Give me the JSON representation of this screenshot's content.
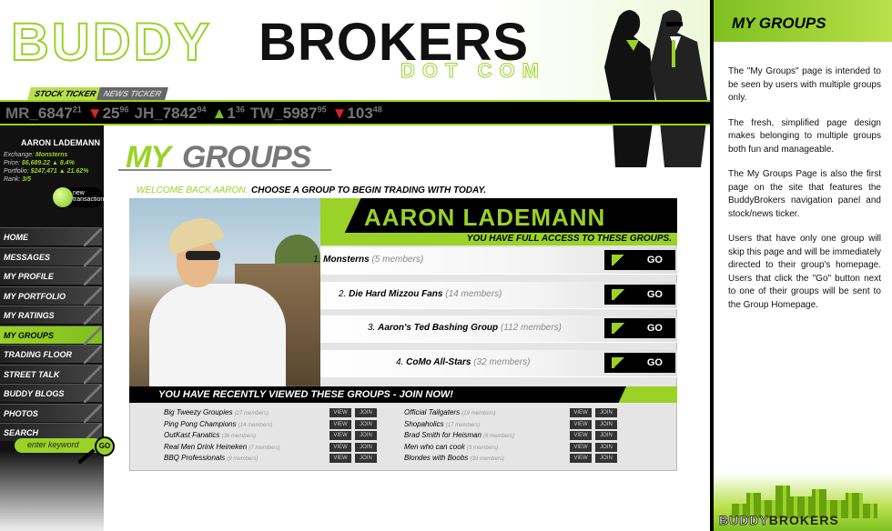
{
  "header": {
    "logo_part1": "BUDDY",
    "logo_part2": "BROKERS",
    "logo_sub": "DOT COM",
    "tab_stock": "STOCK TICKER",
    "tab_news": "NEWS TICKER"
  },
  "ticker": [
    {
      "sym": "MR",
      "val": "_6847",
      "sup": "21",
      "dir": "none"
    },
    {
      "sym": "▼",
      "val": "25",
      "sup": "96",
      "dir": "down"
    },
    {
      "sym": "JH",
      "val": "_7842",
      "sup": "94",
      "dir": "none"
    },
    {
      "sym": "▲",
      "val": "1",
      "sup": "36",
      "dir": "up"
    },
    {
      "sym": "TW",
      "val": "_5987",
      "sup": "95",
      "dir": "none"
    },
    {
      "sym": "▼",
      "val": "103",
      "sup": "48",
      "dir": "down"
    }
  ],
  "profile": {
    "name": "AARON LADEMANN",
    "exchange_label": "Exchange:",
    "exchange": "Monsterns",
    "price_label": "Price:",
    "price": "$6,689.22",
    "price_chg": "▲ 8.4%",
    "portfolio_label": "Portfolio:",
    "portfolio": "$247,471",
    "portfolio_chg": "▲ 21.62%",
    "rank_label": "Rank:",
    "rank": "3/5",
    "new_tx": "new transaction"
  },
  "nav": [
    "HOME",
    "MESSAGES",
    "MY PROFILE",
    "MY PORTFOLIO",
    "MY RATINGS",
    "MY GROUPS",
    "TRADING FLOOR",
    "STREET TALK",
    "BUDDY BLOGS",
    "PHOTOS",
    "SEARCH"
  ],
  "nav_active": "MY GROUPS",
  "search": {
    "placeholder": "enter keyword",
    "go": "GO"
  },
  "page": {
    "title_a": "MY",
    "title_b": "GROUPS",
    "welcome": "WELCOME BACK AARON.",
    "choose": "CHOOSE A GROUP TO BEGIN TRADING WITH TODAY."
  },
  "user_banner": {
    "name": "AARON LADEMANN",
    "access": "YOU HAVE FULL ACCESS TO THESE GROUPS."
  },
  "groups": [
    {
      "n": "1.",
      "name": "Monsterns",
      "members": "(5 members)",
      "go": "GO"
    },
    {
      "n": "2.",
      "name": "Die Hard Mizzou Fans",
      "members": "(14 members)",
      "go": "GO"
    },
    {
      "n": "3.",
      "name": "Aaron's Ted Bashing Group",
      "members": "(112 members)",
      "go": "GO"
    },
    {
      "n": "4.",
      "name": "CoMo All-Stars",
      "members": "(32 members)",
      "go": "GO"
    }
  ],
  "recent": {
    "title": "YOU HAVE RECENTLY VIEWED THESE GROUPS - JOIN NOW!",
    "view": "VIEW",
    "join": "JOIN",
    "left": [
      {
        "name": "Big Tweezy Groupies",
        "members": "(27 members)"
      },
      {
        "name": "Ping Pong Champions",
        "members": "(14 members)"
      },
      {
        "name": "OutKast Fanatics",
        "members": "(36 members)"
      },
      {
        "name": "Real Men Drink Heineken",
        "members": "(7 members)"
      },
      {
        "name": "BBQ Professionals",
        "members": "(9 members)"
      }
    ],
    "right": [
      {
        "name": "Official Tailgaters",
        "members": "(19 members)"
      },
      {
        "name": "Shopaholics",
        "members": "(17 members)"
      },
      {
        "name": "Brad Smith for Heisman",
        "members": "(6 members)"
      },
      {
        "name": "Men who can cook",
        "members": "(3 members)"
      },
      {
        "name": "Blondes with Boobs",
        "members": "(39 members)"
      }
    ]
  },
  "right_panel": {
    "title": "MY GROUPS",
    "paras": [
      "The \"My Groups\" page is intended to be seen by users with multiple groups only.",
      "The fresh, simplified page design makes belonging to multiple groups both fun and manageable.",
      "The My Groups Page is also the first page on the site that features the BuddyBrokers navigation panel and stock/news ticker.",
      "Users that have only one group will skip this page and will be immediately directed to their group's homepage. Users that click the \"Go\" button next to one of their groups will be sent to the Group Homepage."
    ],
    "logo_a": "BUDDY",
    "logo_b": "BROKERS"
  },
  "colors": {
    "accent": "#9ad227",
    "dark": "#000000",
    "down": "#dd2222",
    "up": "#7ec01f"
  }
}
